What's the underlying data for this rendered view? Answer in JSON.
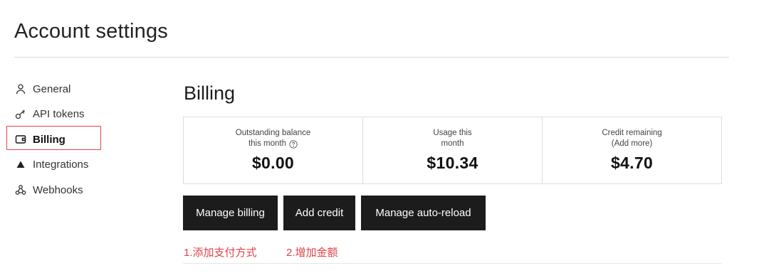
{
  "page": {
    "title": "Account settings"
  },
  "sidebar": {
    "items": [
      {
        "label": "General",
        "icon": "user-icon",
        "active": false
      },
      {
        "label": "API tokens",
        "icon": "key-icon",
        "active": false
      },
      {
        "label": "Billing",
        "icon": "wallet-icon",
        "active": true
      },
      {
        "label": "Integrations",
        "icon": "triangle-icon",
        "active": false
      },
      {
        "label": "Webhooks",
        "icon": "webhook-icon",
        "active": false
      }
    ]
  },
  "billing": {
    "title": "Billing",
    "stats": [
      {
        "label_line1": "Outstanding balance",
        "label_line2": "this month",
        "has_help": true,
        "value": "$0.00"
      },
      {
        "label_line1": "Usage this",
        "label_line2": "month",
        "has_help": false,
        "value": "$10.34"
      },
      {
        "label_line1": "Credit remaining",
        "label_line2": "(Add more)",
        "has_help": false,
        "value": "$4.70"
      }
    ],
    "buttons": {
      "manage_billing": "Manage billing",
      "add_credit": "Add credit",
      "manage_auto_reload": "Manage auto-reload"
    }
  },
  "annotations": {
    "step1": "1.添加支付方式",
    "step2": "2.增加金额",
    "color": "#e0424a"
  }
}
